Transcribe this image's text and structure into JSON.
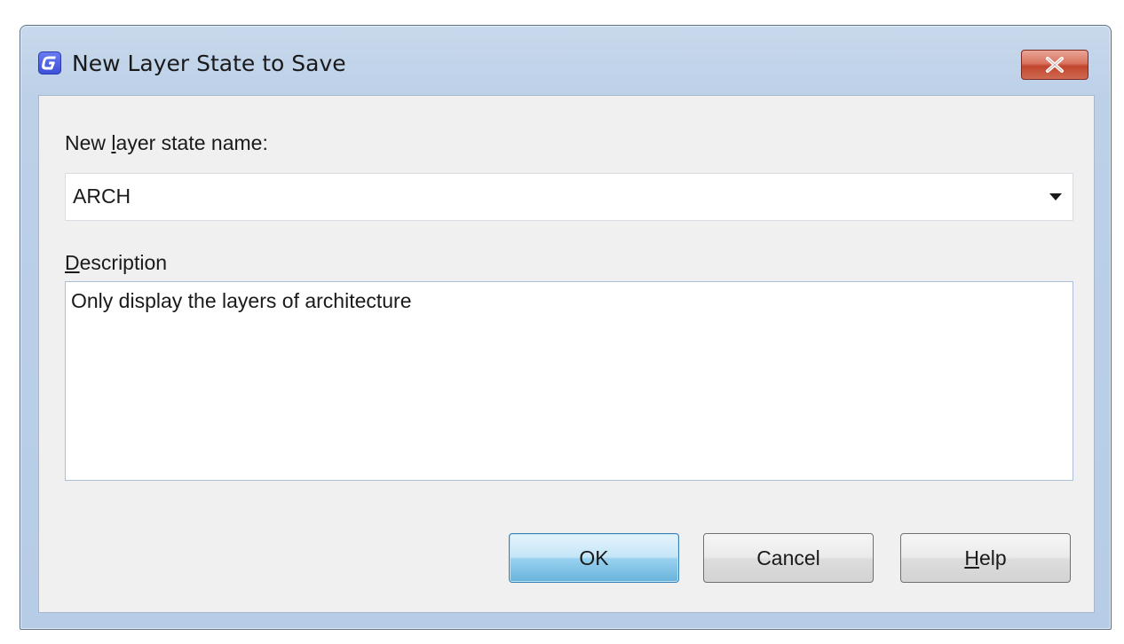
{
  "window": {
    "title": "New Layer State to Save",
    "icon": "app-g-icon",
    "close_icon": "close-icon"
  },
  "form": {
    "name_label_prefix": "New ",
    "name_label_mnemonic": "l",
    "name_label_suffix": "ayer state name:",
    "name_value": "ARCH",
    "description_label_mnemonic": "D",
    "description_label_suffix": "escription",
    "description_value": "Only display the layers of architecture"
  },
  "buttons": {
    "ok_label": "OK",
    "cancel_label": "Cancel",
    "help_mnemonic": "H",
    "help_suffix": "elp"
  },
  "colors": {
    "accent": "#3c7fb1",
    "close_red": "#c2452d",
    "title_bar": "#c9d9ec"
  }
}
